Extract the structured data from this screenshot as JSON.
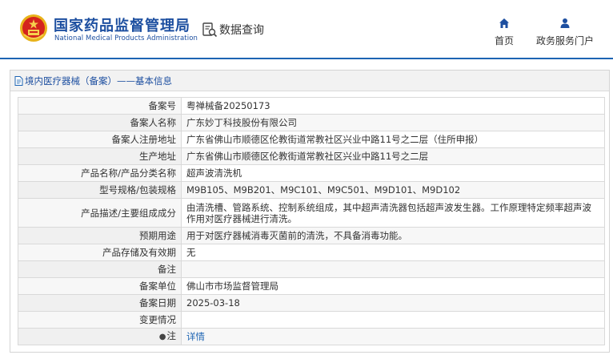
{
  "header": {
    "brand_cn": "国家药品监督管理局",
    "brand_en": "National Medical Products Administration",
    "query_label": "数据查询",
    "nav": [
      {
        "label": "首页",
        "icon": "home-icon"
      },
      {
        "label": "政务服务门户",
        "icon": "user-icon"
      }
    ],
    "accent_color": "#1d64b3"
  },
  "panel": {
    "title": "境内医疗器械（备案）——基本信息"
  },
  "record": {
    "rows": [
      {
        "label": "备案号",
        "value": "粤禅械备20250173"
      },
      {
        "label": "备案人名称",
        "value": "广东妙丁科技股份有限公司"
      },
      {
        "label": "备案人注册地址",
        "value": "广东省佛山市顺德区伦教街道常教社区兴业中路11号之二层（住所申报）"
      },
      {
        "label": "生产地址",
        "value": "广东省佛山市顺德区伦教街道常教社区兴业中路11号之二层"
      },
      {
        "label": "产品名称/产品分类名称",
        "value": "超声波清洗机"
      },
      {
        "label": "型号规格/包装规格",
        "value": "M9B105、M9B201、M9C101、M9C501、M9D101、M9D102"
      },
      {
        "label": "产品描述/主要组成成分",
        "value": "由清洗槽、管路系统、控制系统组成，其中超声清洗器包括超声波发生器。工作原理特定频率超声波作用对医疗器械进行清洗。"
      },
      {
        "label": "预期用途",
        "value": "用于对医疗器械消毒灭菌前的清洗，不具备消毒功能。"
      },
      {
        "label": "产品存储及有效期",
        "value": "无"
      },
      {
        "label": "备注",
        "value": ""
      },
      {
        "label": "备案单位",
        "value": "佛山市市场监督管理局"
      },
      {
        "label": "备案日期",
        "value": "2025-03-18"
      },
      {
        "label": "变更情况",
        "value": ""
      }
    ],
    "note_label": "注",
    "note_link": "详情"
  }
}
